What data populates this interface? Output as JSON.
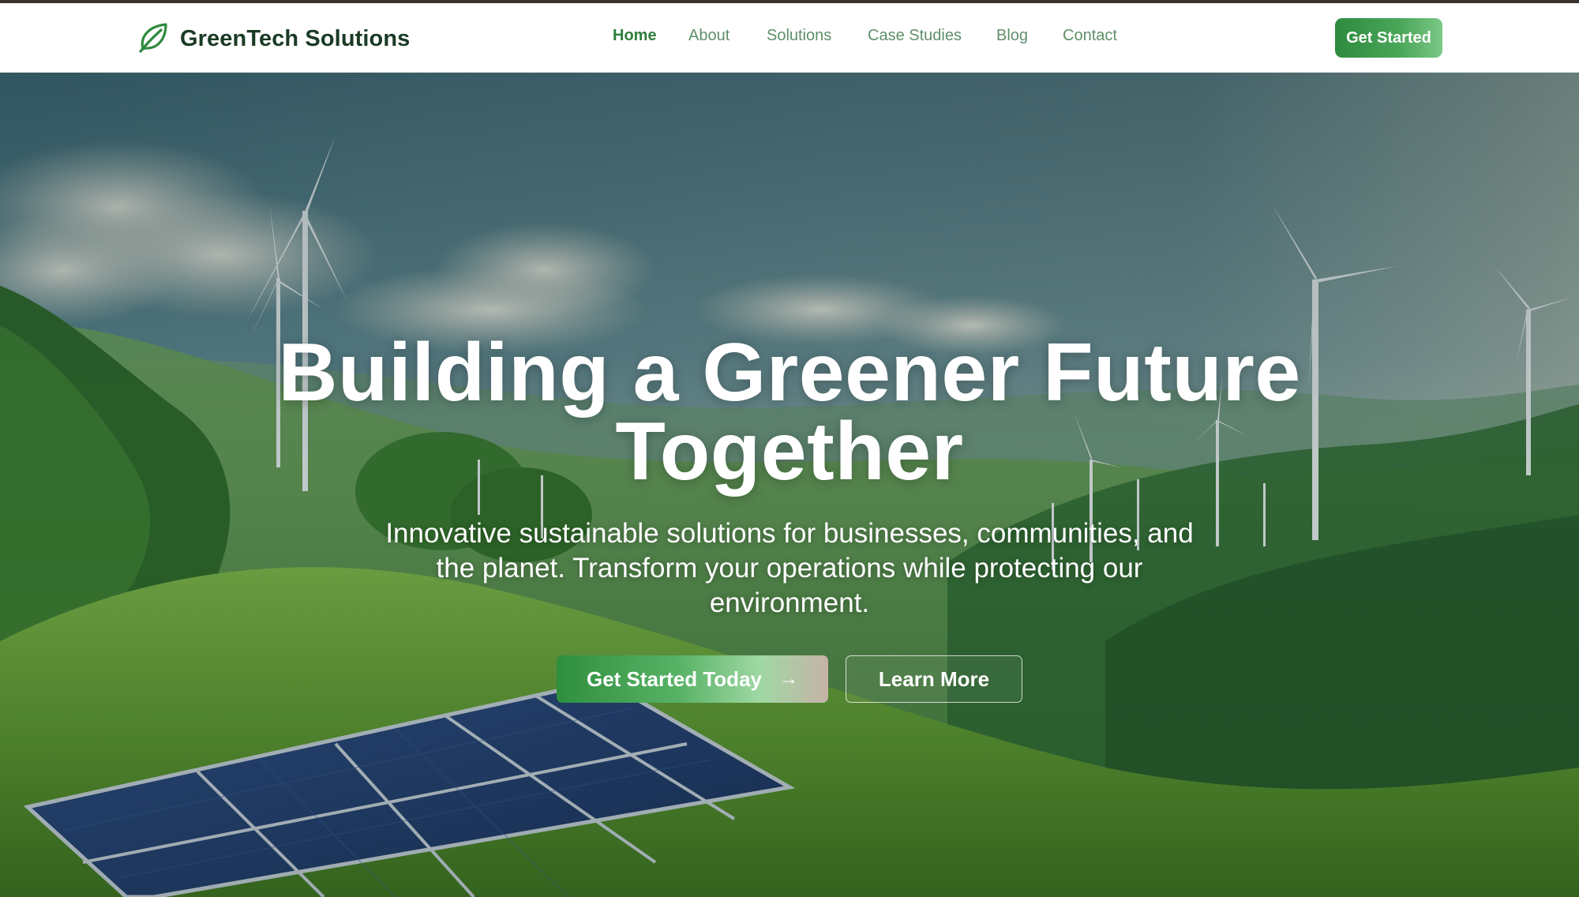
{
  "brand": {
    "name": "GreenTech Solutions",
    "logo_icon": "leaf-icon",
    "color": "#1a3a24"
  },
  "nav": {
    "items": [
      {
        "label": "Home",
        "active": true
      },
      {
        "label": "About",
        "active": false
      },
      {
        "label": "Solutions",
        "active": false
      },
      {
        "label": "Case Studies",
        "active": false
      },
      {
        "label": "Blog",
        "active": false
      },
      {
        "label": "Contact",
        "active": false
      }
    ],
    "cta_label": "Get Started",
    "link_color": "#5f8f69",
    "active_color": "#2e7d3b"
  },
  "hero": {
    "title_line1": "Building a Greener Future",
    "title_line2": "Together",
    "subtitle_line1": "Innovative sustainable solutions for businesses, communities, and",
    "subtitle_line2": "the planet. Transform your operations while protecting our",
    "subtitle_line3": "environment.",
    "primary_button": {
      "label": "Get Started Today",
      "icon": "arrow-right-icon",
      "glyph": "→"
    },
    "secondary_button": {
      "label": "Learn More"
    },
    "background": "landscape with wind turbines and solar panels on green hills"
  },
  "colors": {
    "accent": "#2e8b3e",
    "accent_light": "#7cc886",
    "top_strip": "#3a3128"
  }
}
